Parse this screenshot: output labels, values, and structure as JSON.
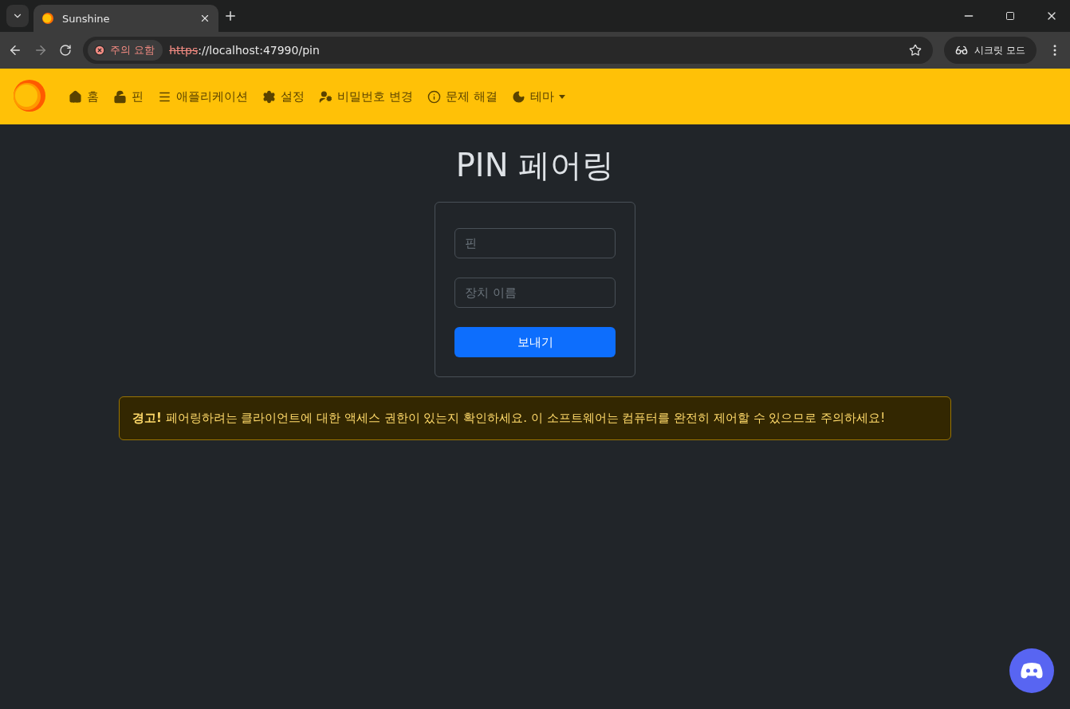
{
  "browser": {
    "tab": {
      "title": "Sunshine",
      "selected": true
    },
    "security_chip": "주의 요함",
    "url": {
      "scheme": "https",
      "rest": "://localhost:47990/pin"
    },
    "incognito": "시크릿 모드"
  },
  "navbar": {
    "items": [
      {
        "kind": "home",
        "label": "홈",
        "dropdown": false
      },
      {
        "kind": "lock",
        "label": "핀",
        "dropdown": false
      },
      {
        "kind": "list",
        "label": "애플리케이션",
        "dropdown": false
      },
      {
        "kind": "gear",
        "label": "설정",
        "dropdown": false
      },
      {
        "kind": "user",
        "label": "비밀번호 변경",
        "dropdown": false
      },
      {
        "kind": "info",
        "label": "문제 해결",
        "dropdown": false
      },
      {
        "kind": "moon",
        "label": "테마",
        "dropdown": true
      }
    ]
  },
  "page": {
    "title": "PIN 페어링",
    "form": {
      "fields": [
        {
          "placeholder": "핀"
        },
        {
          "placeholder": "장치 이름"
        }
      ],
      "submit": "보내기"
    },
    "alert": "**경고!** 페어링하려는 클라이언트에 대한 액세스 권한이 있는지 확인하세요. 이 소프트웨어는 컴퓨터를 완전히 제어할 수 있으므로 주의하세요!"
  }
}
